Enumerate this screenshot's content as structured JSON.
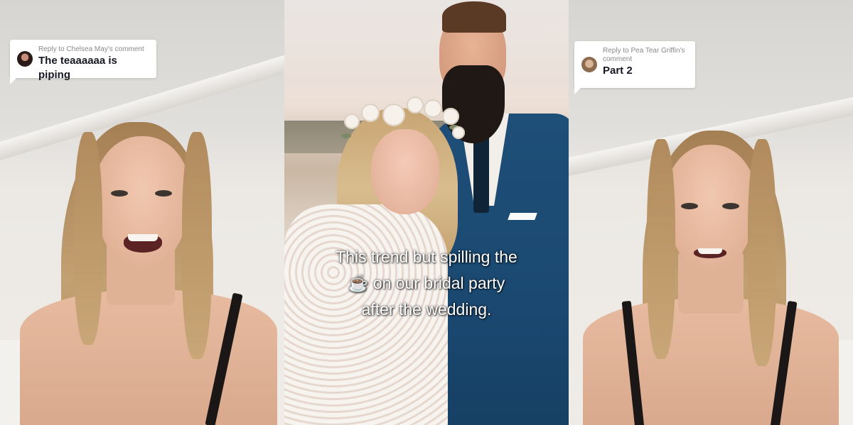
{
  "left_video": {
    "reply_label": "Reply to Chelsea May's comment",
    "comment_text": "The teaaaaaa is piping"
  },
  "center_video": {
    "caption_line1": "This trend but spilling the",
    "caption_emoji": "☕",
    "caption_line2": "on our bridal party",
    "caption_line3": "after the wedding."
  },
  "right_video": {
    "reply_label": "Reply to Pea Tear Griffin's comment",
    "comment_text": "Part 2"
  }
}
